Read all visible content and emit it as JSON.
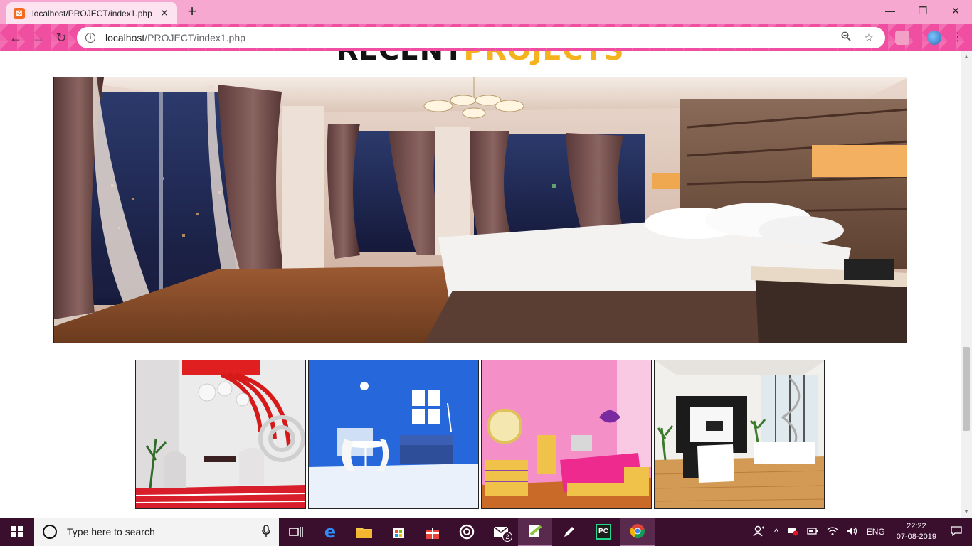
{
  "browser": {
    "tab_title": "localhost/PROJECT/index1.php",
    "tab_close": "✕",
    "new_tab": "+",
    "url_host": "localhost",
    "url_path": "/PROJECT/index1.php",
    "window_controls": [
      "—",
      "❐",
      "✕"
    ]
  },
  "page": {
    "heading_word1": "RECENT",
    "heading_word2": "PROJECTS",
    "accent_color": "#f5b21f",
    "hero_image": "luxury-bedroom-photo",
    "thumbnails": [
      {
        "name": "red-white-modern-room-photo"
      },
      {
        "name": "blue-dining-room-photo"
      },
      {
        "name": "pink-kids-bedroom-photo"
      },
      {
        "name": "white-living-room-photo"
      }
    ]
  },
  "taskbar": {
    "search_placeholder": "Type here to search",
    "mail_badge": "2",
    "language": "ENG",
    "time": "22:22",
    "date": "07-08-2019"
  }
}
